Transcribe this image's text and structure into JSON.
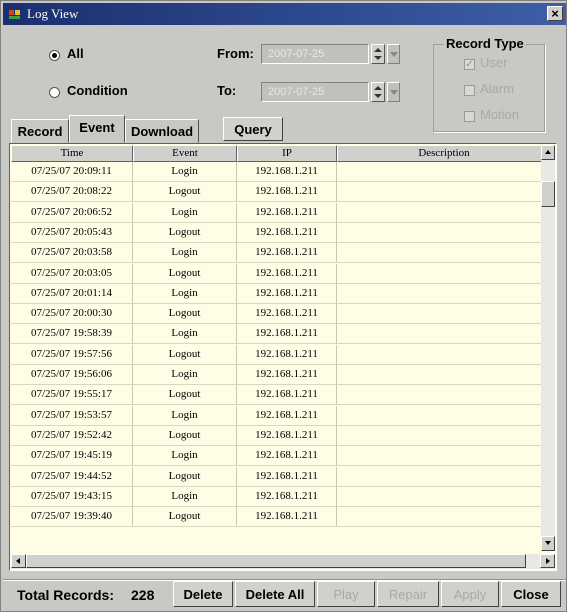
{
  "window": {
    "title": "Log View",
    "close_label": "×"
  },
  "mode": {
    "all_label": "All",
    "condition_label": "Condition",
    "selected": "All"
  },
  "range": {
    "from_label": "From:",
    "to_label": "To:",
    "from_value": "2007-07-25",
    "to_value": "2007-07-25"
  },
  "record_type": {
    "legend": "Record Type",
    "options": [
      {
        "label": "User",
        "checked": true
      },
      {
        "label": "Alarm",
        "checked": false
      },
      {
        "label": "Motion",
        "checked": false
      }
    ]
  },
  "tabs": {
    "record": "Record",
    "event": "Event",
    "download": "Download",
    "active": "Event"
  },
  "query_label": "Query",
  "table": {
    "columns": [
      "Time",
      "Event",
      "IP",
      "Description"
    ],
    "rows": [
      [
        "07/25/07 20:09:11",
        "Login",
        "192.168.1.211",
        ""
      ],
      [
        "07/25/07 20:08:22",
        "Logout",
        "192.168.1.211",
        ""
      ],
      [
        "07/25/07 20:06:52",
        "Login",
        "192.168.1.211",
        ""
      ],
      [
        "07/25/07 20:05:43",
        "Logout",
        "192.168.1.211",
        ""
      ],
      [
        "07/25/07 20:03:58",
        "Login",
        "192.168.1.211",
        ""
      ],
      [
        "07/25/07 20:03:05",
        "Logout",
        "192.168.1.211",
        ""
      ],
      [
        "07/25/07 20:01:14",
        "Login",
        "192.168.1.211",
        ""
      ],
      [
        "07/25/07 20:00:30",
        "Logout",
        "192.168.1.211",
        ""
      ],
      [
        "07/25/07 19:58:39",
        "Login",
        "192.168.1.211",
        ""
      ],
      [
        "07/25/07 19:57:56",
        "Logout",
        "192.168.1.211",
        ""
      ],
      [
        "07/25/07 19:56:06",
        "Login",
        "192.168.1.211",
        ""
      ],
      [
        "07/25/07 19:55:17",
        "Logout",
        "192.168.1.211",
        ""
      ],
      [
        "07/25/07 19:53:57",
        "Login",
        "192.168.1.211",
        ""
      ],
      [
        "07/25/07 19:52:42",
        "Logout",
        "192.168.1.211",
        ""
      ],
      [
        "07/25/07 19:45:19",
        "Login",
        "192.168.1.211",
        ""
      ],
      [
        "07/25/07 19:44:52",
        "Logout",
        "192.168.1.211",
        ""
      ],
      [
        "07/25/07 19:43:15",
        "Login",
        "192.168.1.211",
        ""
      ],
      [
        "07/25/07 19:39:40",
        "Logout",
        "192.168.1.211",
        ""
      ]
    ]
  },
  "footer": {
    "total_label": "Total Records:",
    "total_value": "228",
    "buttons": [
      {
        "label": "Delete",
        "enabled": true
      },
      {
        "label": "Delete All",
        "enabled": true
      },
      {
        "label": "Play",
        "enabled": false
      },
      {
        "label": "Repair",
        "enabled": false
      },
      {
        "label": "Apply",
        "enabled": false
      },
      {
        "label": "Close",
        "enabled": true
      }
    ]
  },
  "colors": {
    "titlebar": "#1a2f6e",
    "list_bg": "#fffde6",
    "window_bg": "#c8c8c4"
  }
}
